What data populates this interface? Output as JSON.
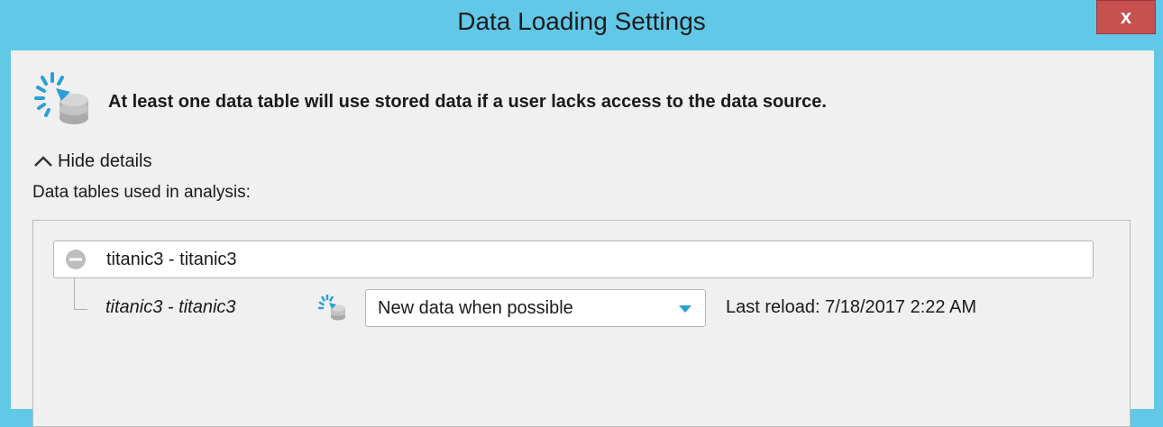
{
  "window": {
    "title": "Data Loading Settings",
    "close_label": "x"
  },
  "dialog": {
    "info_icon": "stored-data-icon",
    "info_message": "At least one data table will use stored data if a user lacks access to the data source.",
    "toggle_label": "Hide details",
    "toggle_icon": "chevron-up-icon",
    "tables_label": "Data tables used in analysis:"
  },
  "tables": [
    {
      "group_name": "titanic3 - titanic3",
      "collapse_icon": "collapse-minus-icon",
      "children": [
        {
          "name": "titanic3 - titanic3",
          "icon": "stored-data-icon",
          "loading_option": "New data when possible",
          "last_reload": "Last reload: 7/18/2017 2:22 AM"
        }
      ]
    }
  ],
  "colors": {
    "title_bar": "#62c8e8",
    "close_button": "#c75050",
    "dialog_bg": "#f0f0f0",
    "accent_blue": "#2a9fd8"
  }
}
